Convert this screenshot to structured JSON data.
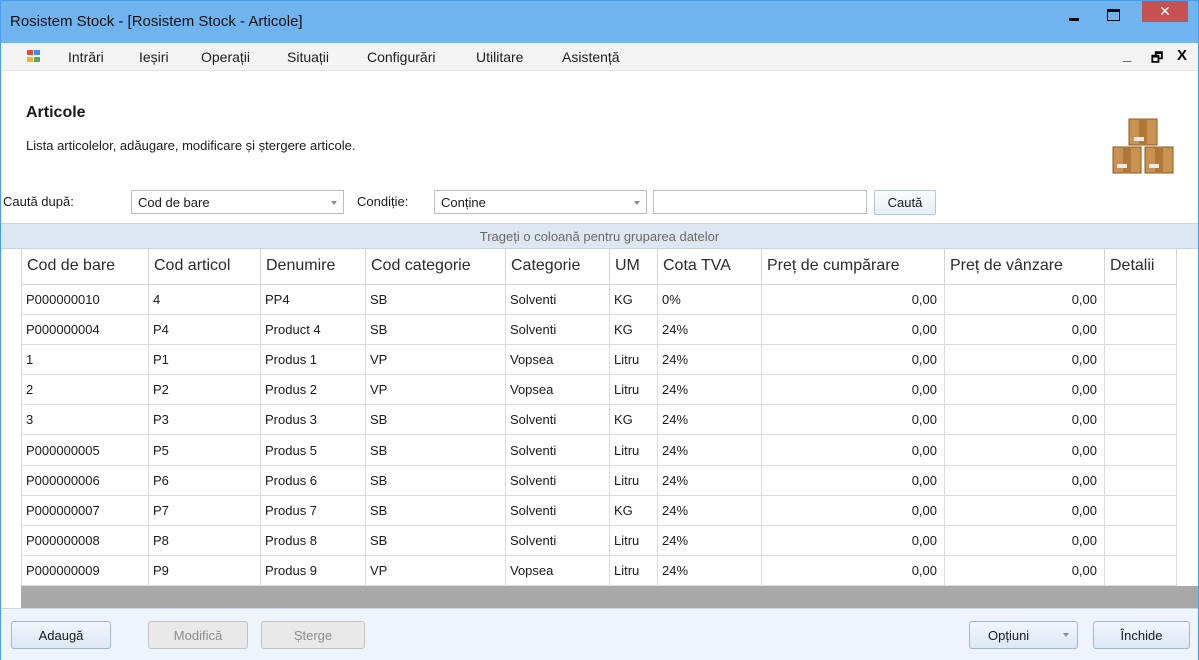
{
  "window": {
    "title": "Rosistem Stock - [Rosistem Stock - Articole]",
    "close_glyph": "✕"
  },
  "menu": {
    "items": [
      "Intrări",
      "Ieșiri",
      "Operații",
      "Situații",
      "Configurări",
      "Utilitare",
      "Asistență"
    ],
    "mdi_minimize": "_",
    "mdi_restore": "🗗",
    "mdi_close": "X"
  },
  "header": {
    "title": "Articole",
    "description": "Lista articolelor, adăugare, modificare și ștergere articole."
  },
  "filter": {
    "search_by_label": "Caută după:",
    "search_by_value": "Cod de bare",
    "condition_label": "Condiție:",
    "condition_value": "Conține",
    "search_text_value": "",
    "find_button": "Caută"
  },
  "grid": {
    "group_panel_text": "Trageți o coloană pentru gruparea datelor",
    "columns": [
      "Cod de bare",
      "Cod articol",
      "Denumire",
      "Cod categorie",
      "Categorie",
      "UM",
      "Cota TVA",
      "Preț de cumpărare",
      "Preț de vânzare",
      "Detalii"
    ],
    "rows": [
      [
        "P000000010",
        "4",
        "PP4",
        "SB",
        "Solventi",
        "KG",
        "0%",
        "0,00",
        "0,00",
        ""
      ],
      [
        "P000000004",
        "P4",
        "Product 4",
        "SB",
        "Solventi",
        "KG",
        "24%",
        "0,00",
        "0,00",
        ""
      ],
      [
        "1",
        "P1",
        "Produs 1",
        "VP",
        "Vopsea",
        "Litru",
        "24%",
        "0,00",
        "0,00",
        ""
      ],
      [
        "2",
        "P2",
        "Produs 2",
        "VP",
        "Vopsea",
        "Litru",
        "24%",
        "0,00",
        "0,00",
        ""
      ],
      [
        "3",
        "P3",
        "Produs 3",
        "SB",
        "Solventi",
        "KG",
        "24%",
        "0,00",
        "0,00",
        ""
      ],
      [
        "P000000005",
        "P5",
        "Produs 5",
        "SB",
        "Solventi",
        "Litru",
        "24%",
        "0,00",
        "0,00",
        ""
      ],
      [
        "P000000006",
        "P6",
        "Produs 6",
        "SB",
        "Solventi",
        "Litru",
        "24%",
        "0,00",
        "0,00",
        ""
      ],
      [
        "P000000007",
        "P7",
        "Produs 7",
        "SB",
        "Solventi",
        "KG",
        "24%",
        "0,00",
        "0,00",
        ""
      ],
      [
        "P000000008",
        "P8",
        "Produs 8",
        "SB",
        "Solventi",
        "Litru",
        "24%",
        "0,00",
        "0,00",
        ""
      ],
      [
        "P000000009",
        "P9",
        "Produs 9",
        "VP",
        "Vopsea",
        "Litru",
        "24%",
        "0,00",
        "0,00",
        ""
      ]
    ]
  },
  "footer": {
    "add_button": "Adaugă",
    "edit_button": "Modifică",
    "delete_button": "Șterge",
    "options_button": "Opțiuni",
    "close_button": "Închide"
  },
  "colors": {
    "titlebar": "#6fb4ef",
    "close_button": "#c75050",
    "group_panel": "#dde7f1",
    "footer": "#eef4fb"
  },
  "icons": [
    "app-icon",
    "boxes-icon",
    "dropdown-arrow-icon"
  ]
}
